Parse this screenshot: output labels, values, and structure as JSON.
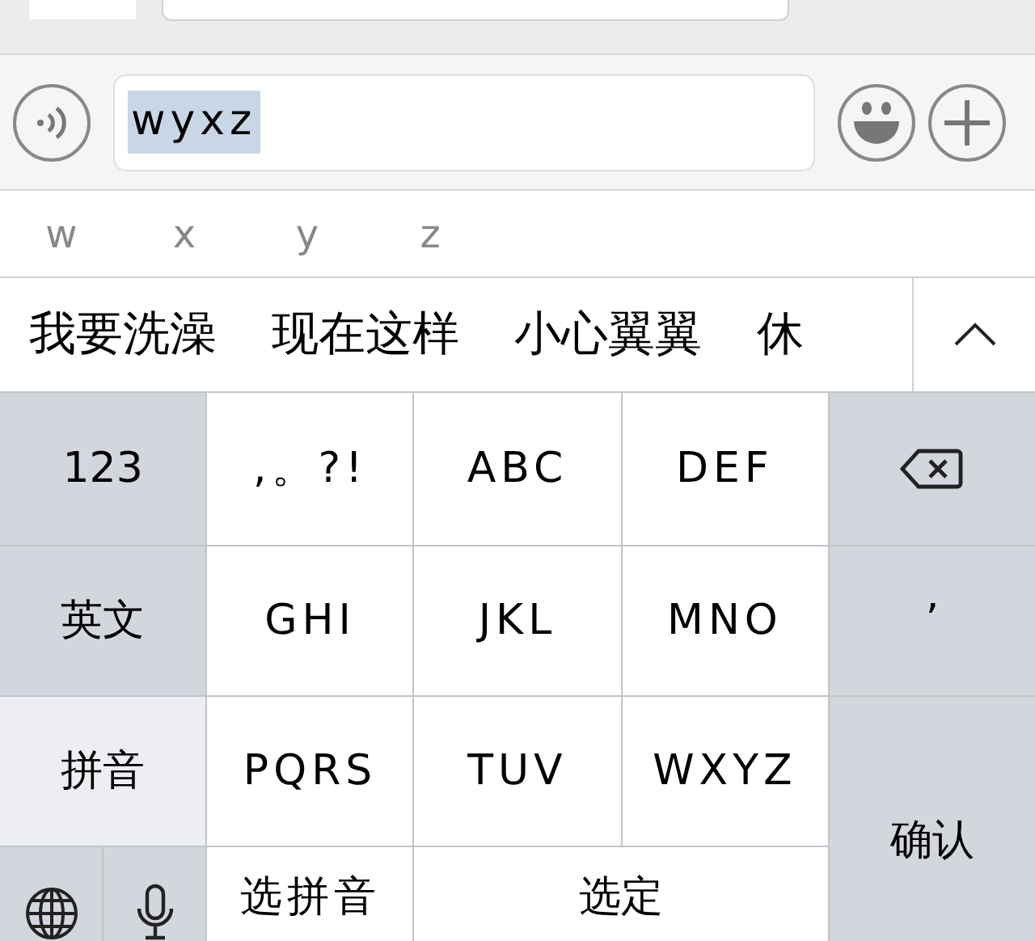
{
  "message_field": {
    "value": "wyxz",
    "selected": true
  },
  "pinyin_options": [
    "w",
    "x",
    "y",
    "z"
  ],
  "candidates": [
    "我要洗澡",
    "现在这样",
    "小心翼翼",
    "休"
  ],
  "keys": [
    {
      "kind": "function",
      "label": "123"
    },
    {
      "kind": "letter",
      "label": ",。?!"
    },
    {
      "kind": "letter",
      "label": "ABC"
    },
    {
      "kind": "letter",
      "label": "DEF"
    },
    {
      "kind": "delete"
    },
    {
      "kind": "mode",
      "label": "英文",
      "selected": false
    },
    {
      "kind": "letter",
      "label": "GHI"
    },
    {
      "kind": "letter",
      "label": "JKL"
    },
    {
      "kind": "letter",
      "label": "MNO"
    },
    {
      "kind": "function",
      "label": "’"
    },
    {
      "kind": "mode",
      "label": "拼音",
      "selected": true
    },
    {
      "kind": "letter",
      "label": "PQRS"
    },
    {
      "kind": "letter",
      "label": "TUV"
    },
    {
      "kind": "letter",
      "label": "WXYZ"
    },
    {
      "kind": "confirm",
      "label": "确认"
    },
    {
      "kind": "globe"
    },
    {
      "kind": "mic"
    },
    {
      "kind": "letter",
      "label": "选拼音"
    },
    {
      "kind": "wide",
      "label": "选定"
    }
  ]
}
